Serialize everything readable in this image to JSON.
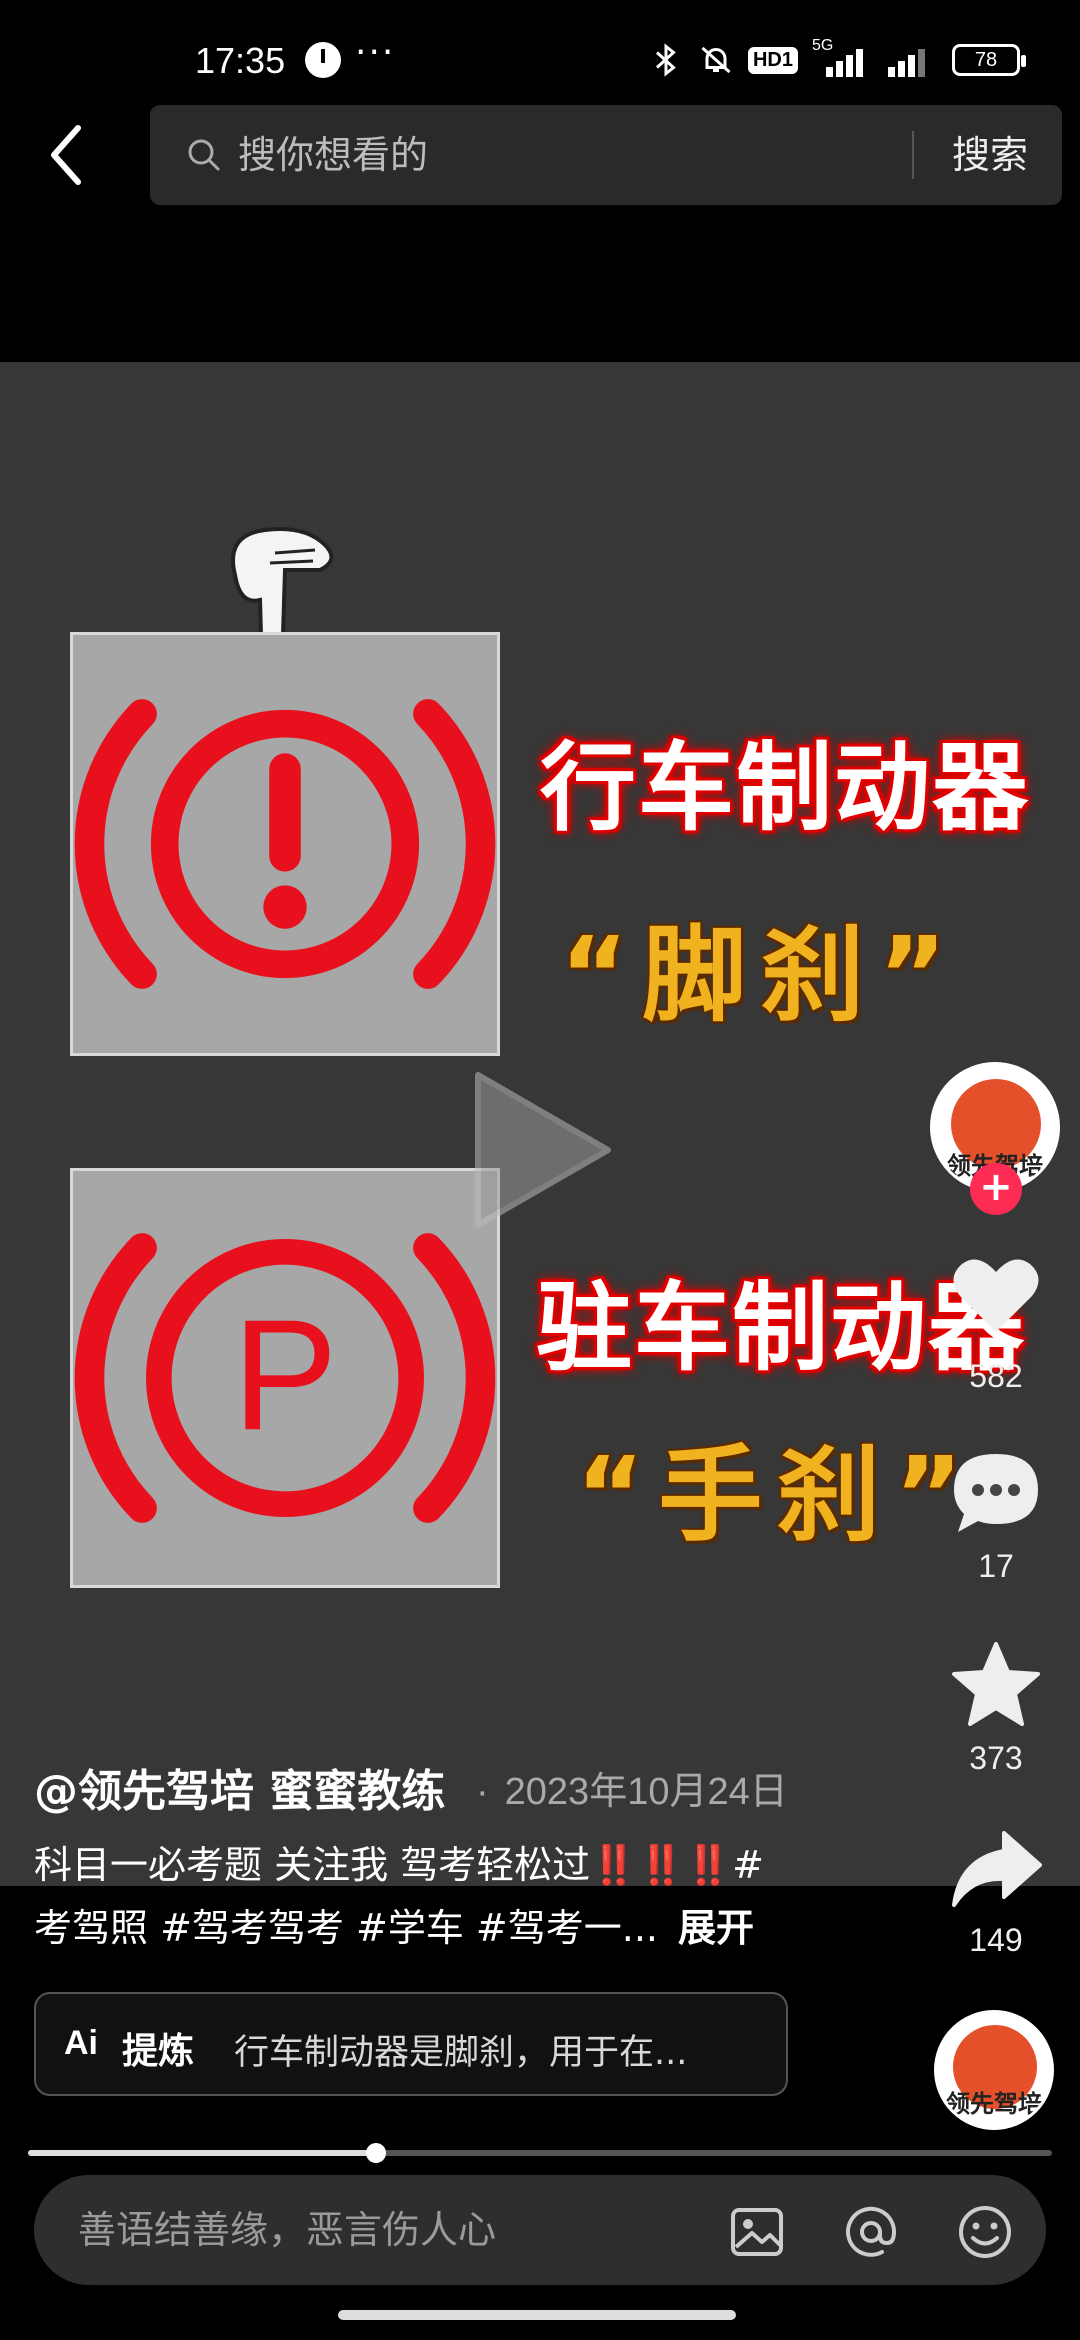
{
  "status_bar": {
    "time": "17:35",
    "more": "···",
    "hd": "HD1",
    "network": "5G",
    "battery": "78"
  },
  "search": {
    "placeholder": "搜你想看的",
    "button_label": "搜索"
  },
  "video": {
    "caption1": "行车制动器",
    "caption1_sub": "“脚刹”",
    "caption2": "驻车制动器",
    "caption2_sub": "“手刹”",
    "sign1_symbol": "!",
    "sign2_symbol": "P"
  },
  "rail": {
    "avatar_text": "领先驾培",
    "follow": "+",
    "like_count": "582",
    "comment_count": "17",
    "favorite_count": "373",
    "share_count": "149",
    "music_avatar_text": "领先驾培"
  },
  "post": {
    "author": "@领先驾培 蜜蜜教练",
    "date": "2023年10月24日",
    "caption_line1": "科目一必考题 关注我 驾考轻松过",
    "caption_bangs": "‼️‼️‼️",
    "caption_hash": "#",
    "caption_line2": "考驾照 #驾考驾考 #学车 #驾考一...",
    "expand": "展开",
    "playback_progress": 0.34
  },
  "summary": {
    "icon_text": "Ai",
    "label": "提炼",
    "text": "行车制动器是脚刹，用于在..."
  },
  "comment": {
    "placeholder": "善语结善缘，恶言伤人心"
  },
  "colors": {
    "accent_red": "#fe2c55",
    "sign_red": "#e8101c",
    "caption_yellow": "#f0b21e"
  }
}
